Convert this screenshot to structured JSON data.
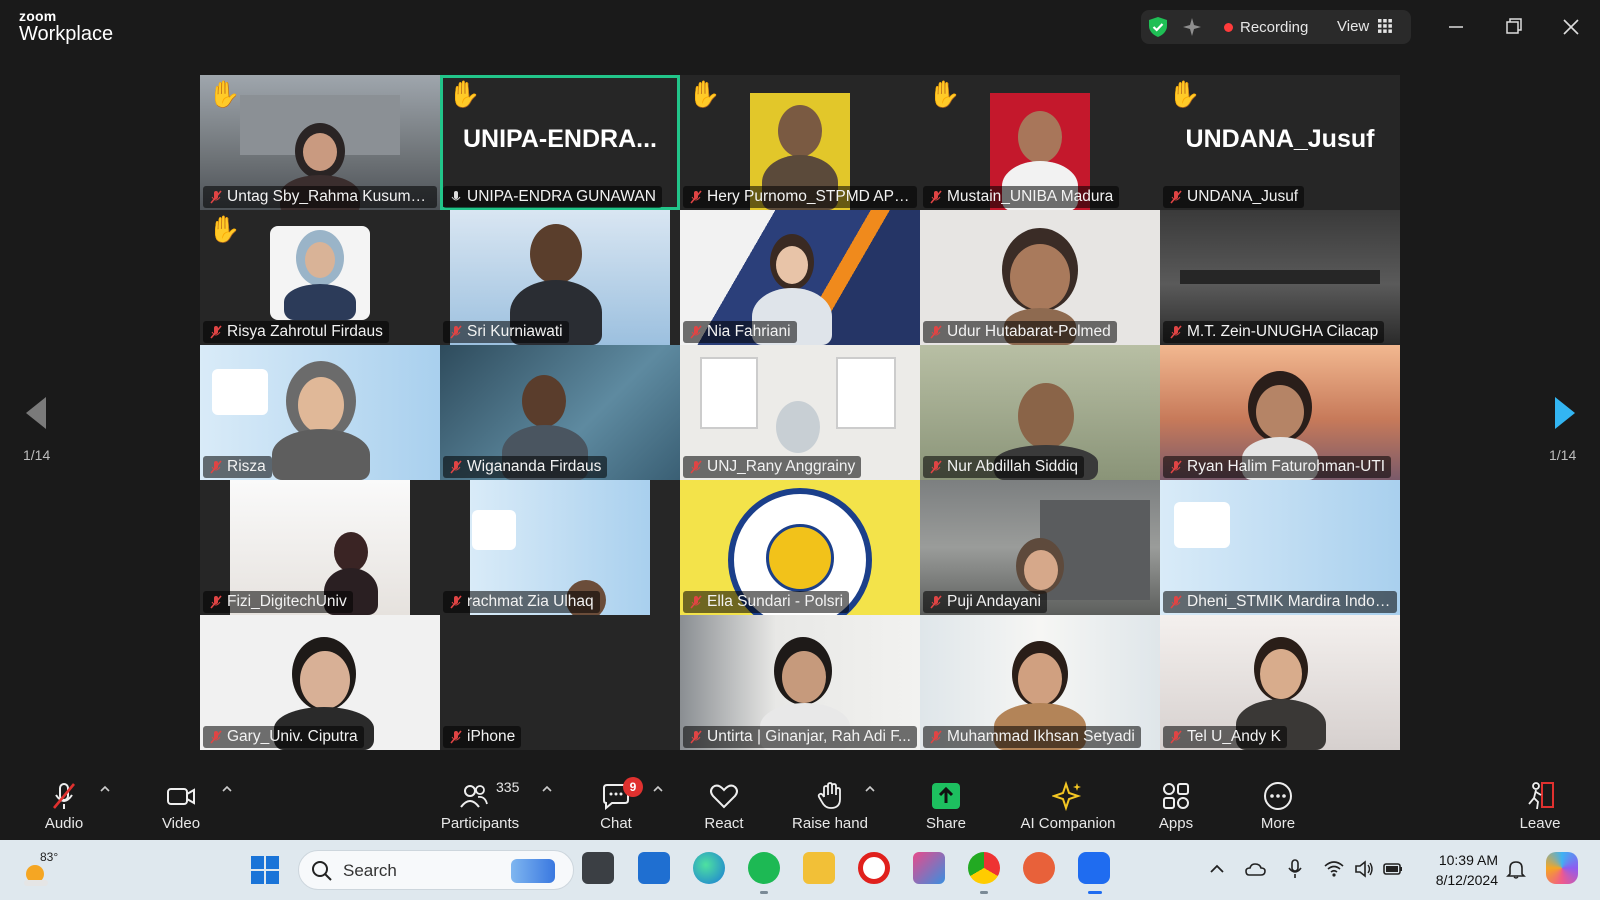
{
  "app": {
    "brand_small": "zoom",
    "brand_big": "Workplace"
  },
  "titlebar": {
    "recording_label": "Recording",
    "view_label": "View"
  },
  "pager": {
    "left": "1/14",
    "right": "1/14"
  },
  "participants": [
    {
      "name": "Untag Sby_Rahma Kusuman...",
      "hand": true
    },
    {
      "name": "UNIPA-ENDRA GUNAWAN",
      "big": "UNIPA-ENDRA...",
      "hand": true,
      "active": true
    },
    {
      "name": "Hery Purnomo_STPMD APMD",
      "hand": true
    },
    {
      "name": "Mustain_UNIBA Madura",
      "hand": true
    },
    {
      "name": "UNDANA_Jusuf",
      "big": "UNDANA_Jusuf",
      "hand": true
    },
    {
      "name": "Risya Zahrotul Firdaus",
      "hand": true
    },
    {
      "name": "Sri Kurniawati"
    },
    {
      "name": "Nia Fahriani"
    },
    {
      "name": "Udur Hutabarat-Polmed"
    },
    {
      "name": "M.T. Zein-UNUGHA Cilacap"
    },
    {
      "name": "Risza"
    },
    {
      "name": "Wigananda Firdaus"
    },
    {
      "name": "UNJ_Rany Anggrainy"
    },
    {
      "name": "Nur Abdillah Siddiq"
    },
    {
      "name": "Ryan Halim Faturohman-UTI"
    },
    {
      "name": "Fizi_DigitechUniv"
    },
    {
      "name": "rachmat Zia Ulhaq"
    },
    {
      "name": "Ella Sundari - Polsri"
    },
    {
      "name": "Puji Andayani"
    },
    {
      "name": "Dheni_STMIK Mardira Indon..."
    },
    {
      "name": "Gary_Univ. Ciputra"
    },
    {
      "name": "iPhone"
    },
    {
      "name": "Untirta | Ginanjar, Rah Adi F..."
    },
    {
      "name": "Muhammad Ikhsan Setyadi"
    },
    {
      "name": "Tel U_Andy K"
    }
  ],
  "toolbar": {
    "audio": "Audio",
    "video": "Video",
    "participants": "Participants",
    "participants_count": "335",
    "chat": "Chat",
    "chat_badge": "9",
    "react": "React",
    "raise_hand": "Raise hand",
    "share": "Share",
    "ai_companion": "AI Companion",
    "apps": "Apps",
    "more": "More",
    "leave": "Leave"
  },
  "taskbar": {
    "weather_temp": "83°",
    "search_label": "Search",
    "time": "10:39 AM",
    "date": "8/12/2024"
  },
  "colors": {
    "active_border": "#22c58a",
    "share_green": "#1dbf5f",
    "hand_yellow": "#f5b800",
    "record_red": "#ff3b3b"
  }
}
